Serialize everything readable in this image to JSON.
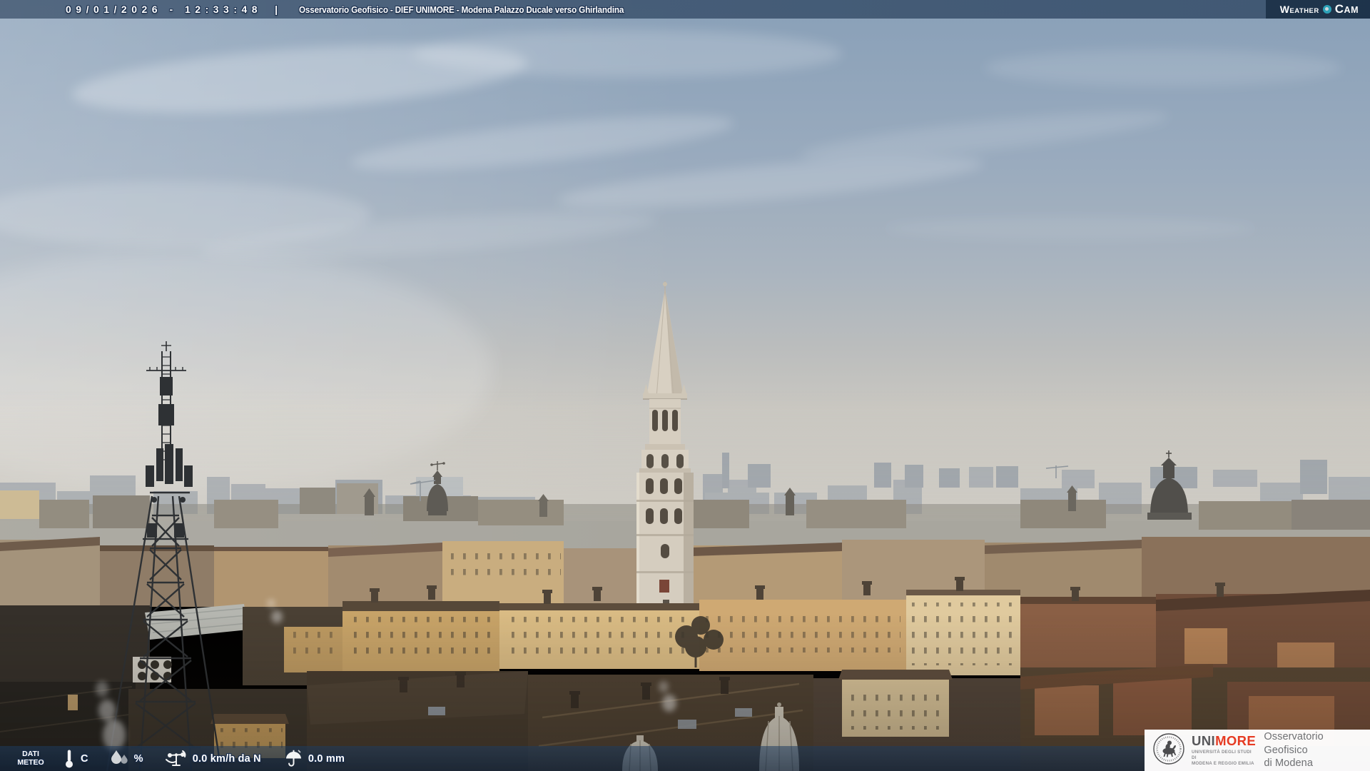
{
  "header": {
    "timestamp": "09/01/2026 - 12:33:48",
    "separator": "|",
    "title": "Osservatorio Geofisico - DIEF UNIMORE - Modena Palazzo Ducale verso Ghirlandina",
    "brand": {
      "weather": "WEATHER",
      "cam": "CAM"
    }
  },
  "footer": {
    "label": {
      "line1": "DATI",
      "line2": "METEO"
    },
    "temperature": {
      "value": "",
      "unit": "C"
    },
    "humidity": {
      "value": "",
      "unit": "%"
    },
    "wind": {
      "text": "0.0 km/h da N"
    },
    "rain": {
      "text": "0.0 mm"
    }
  },
  "logo_box": {
    "acronym": {
      "uni": "UNI",
      "more": "MORE"
    },
    "university_line1": "UNIVERSITÀ DEGLI STUDI DI",
    "university_line2": "MODENA E REGGIO EMILIA",
    "observatory_line1": "Osservatorio Geofisico",
    "observatory_line2": "di Modena"
  },
  "colors": {
    "overlay_navy": "#14314f",
    "brand_teal": "#2da2b8",
    "unimore_red": "#e63b23",
    "seal_gray": "#4c4c4e",
    "sky_top": "#89a0b8",
    "haze": "#c9c7c1"
  }
}
